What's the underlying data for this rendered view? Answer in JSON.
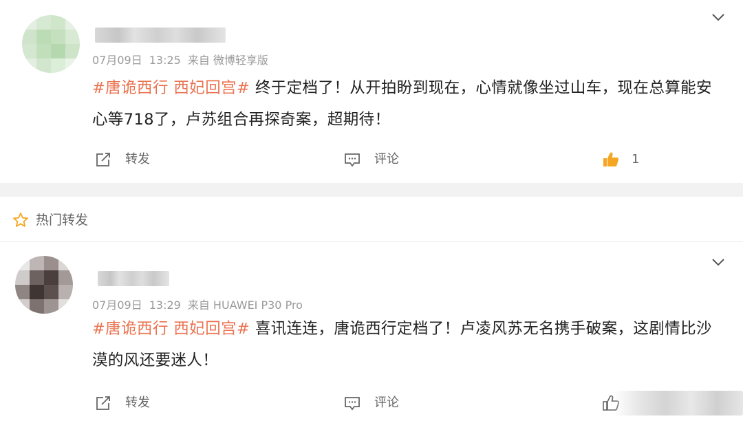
{
  "posts": [
    {
      "date": "07月09日",
      "time": "13:25",
      "source": "来自 微博轻享版",
      "topic": "#唐诡西行 西妃回宫#",
      "text": " 终于定档了！从开拍盼到现在，心情就像坐过山车，现在总算能安心等718了，卢苏组合再探奇案，超期待！",
      "actions": {
        "forward": "转发",
        "comment": "评论",
        "like_count": "1"
      }
    },
    {
      "date": "07月09日",
      "time": "13:29",
      "source": "来自 HUAWEI P30 Pro",
      "topic": "#唐诡西行 西妃回宫#",
      "text": " 喜讯连连，唐诡西行定档了！卢凌风苏无名携手破案，这剧情比沙漠的风还要迷人！",
      "actions": {
        "forward": "转发",
        "comment": "评论"
      }
    }
  ],
  "hot_section": {
    "label": "热门转发",
    "icon": "star-icon"
  },
  "colors": {
    "topic": "#eb7350",
    "like_icon": "#f5a623",
    "meta": "#999999",
    "divider": "#f2f2f2"
  },
  "icons": {
    "forward": "share-icon",
    "comment": "comment-icon",
    "like": "thumbs-up-icon",
    "more": "chevron-down-icon"
  }
}
